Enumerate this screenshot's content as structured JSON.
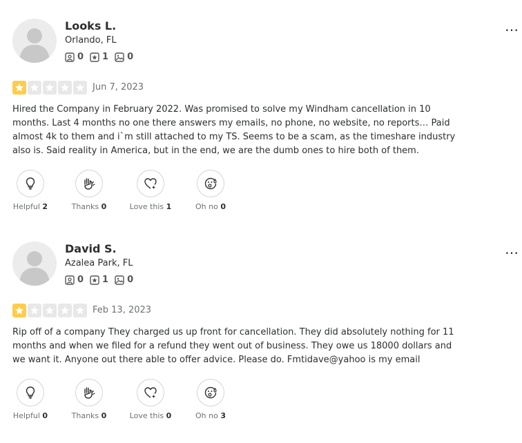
{
  "reviews": [
    {
      "name": "Looks L.",
      "location": "Orlando, FL",
      "counts": {
        "friends": "0",
        "reviews": "1",
        "photos": "0"
      },
      "rating": 1,
      "date": "Jun 7, 2023",
      "text": "Hired the Company in February 2022. Was promised to solve my Windham cancellation in 10 months. Last 4 months no one there answers my emails, no phone, no website, no reports… Paid almost 4k to them and i`m still attached to my TS. Seems to be a scam, as the timeshare industry also is. Said reality in America, but in the end, we are the dumb ones to hire both of them.",
      "more_label": "…",
      "reactions": [
        {
          "label": "Helpful",
          "count": "2"
        },
        {
          "label": "Thanks",
          "count": "0"
        },
        {
          "label": "Love this",
          "count": "1"
        },
        {
          "label": "Oh no",
          "count": "0"
        }
      ]
    },
    {
      "name": "David S.",
      "location": "Azalea Park, FL",
      "counts": {
        "friends": "0",
        "reviews": "1",
        "photos": "0"
      },
      "rating": 1,
      "date": "Feb 13, 2023",
      "text": "Rip off of a company They charged us up front for cancellation. They did absolutely nothing for 11 months and when we filed for a refund they went out of business. They owe us 18000 dollars and we want it. Anyone out there able to offer advice. Please do. Fmtidave@yahoo is my email",
      "more_label": "…",
      "reactions": [
        {
          "label": "Helpful",
          "count": "0"
        },
        {
          "label": "Thanks",
          "count": "0"
        },
        {
          "label": "Love this",
          "count": "0"
        },
        {
          "label": "Oh no",
          "count": "3"
        }
      ]
    }
  ],
  "colors": {
    "star_on": "#ffcc4b",
    "star_off": "#e8e8e8",
    "text": "#2d2e2f",
    "muted": "#6e7072"
  },
  "icons": [
    "user-avatar",
    "friends-icon",
    "review-star-icon",
    "photo-icon",
    "lightbulb-icon",
    "thanks-hands-icon",
    "love-heart-icon",
    "oh-no-face-icon",
    "more-options-icon"
  ]
}
